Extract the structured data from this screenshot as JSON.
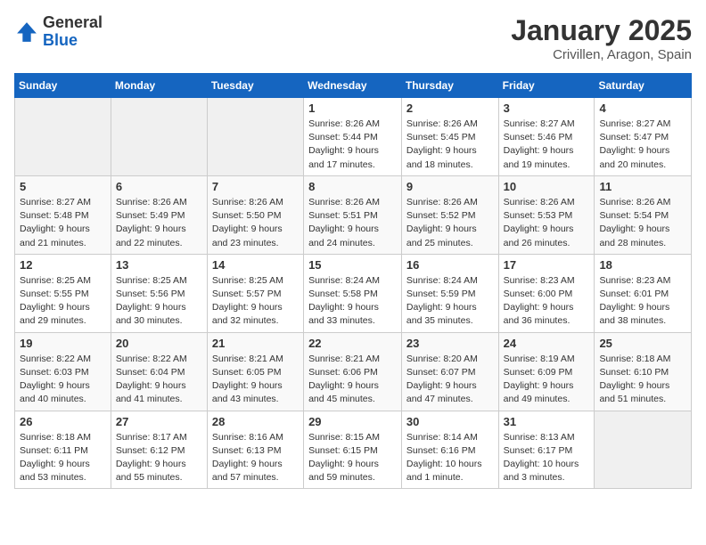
{
  "logo": {
    "general": "General",
    "blue": "Blue"
  },
  "title": "January 2025",
  "subtitle": "Crivillen, Aragon, Spain",
  "days_of_week": [
    "Sunday",
    "Monday",
    "Tuesday",
    "Wednesday",
    "Thursday",
    "Friday",
    "Saturday"
  ],
  "weeks": [
    [
      {
        "day": "",
        "info": ""
      },
      {
        "day": "",
        "info": ""
      },
      {
        "day": "",
        "info": ""
      },
      {
        "day": "1",
        "info": "Sunrise: 8:26 AM\nSunset: 5:44 PM\nDaylight: 9 hours and 17 minutes."
      },
      {
        "day": "2",
        "info": "Sunrise: 8:26 AM\nSunset: 5:45 PM\nDaylight: 9 hours and 18 minutes."
      },
      {
        "day": "3",
        "info": "Sunrise: 8:27 AM\nSunset: 5:46 PM\nDaylight: 9 hours and 19 minutes."
      },
      {
        "day": "4",
        "info": "Sunrise: 8:27 AM\nSunset: 5:47 PM\nDaylight: 9 hours and 20 minutes."
      }
    ],
    [
      {
        "day": "5",
        "info": "Sunrise: 8:27 AM\nSunset: 5:48 PM\nDaylight: 9 hours and 21 minutes."
      },
      {
        "day": "6",
        "info": "Sunrise: 8:26 AM\nSunset: 5:49 PM\nDaylight: 9 hours and 22 minutes."
      },
      {
        "day": "7",
        "info": "Sunrise: 8:26 AM\nSunset: 5:50 PM\nDaylight: 9 hours and 23 minutes."
      },
      {
        "day": "8",
        "info": "Sunrise: 8:26 AM\nSunset: 5:51 PM\nDaylight: 9 hours and 24 minutes."
      },
      {
        "day": "9",
        "info": "Sunrise: 8:26 AM\nSunset: 5:52 PM\nDaylight: 9 hours and 25 minutes."
      },
      {
        "day": "10",
        "info": "Sunrise: 8:26 AM\nSunset: 5:53 PM\nDaylight: 9 hours and 26 minutes."
      },
      {
        "day": "11",
        "info": "Sunrise: 8:26 AM\nSunset: 5:54 PM\nDaylight: 9 hours and 28 minutes."
      }
    ],
    [
      {
        "day": "12",
        "info": "Sunrise: 8:25 AM\nSunset: 5:55 PM\nDaylight: 9 hours and 29 minutes."
      },
      {
        "day": "13",
        "info": "Sunrise: 8:25 AM\nSunset: 5:56 PM\nDaylight: 9 hours and 30 minutes."
      },
      {
        "day": "14",
        "info": "Sunrise: 8:25 AM\nSunset: 5:57 PM\nDaylight: 9 hours and 32 minutes."
      },
      {
        "day": "15",
        "info": "Sunrise: 8:24 AM\nSunset: 5:58 PM\nDaylight: 9 hours and 33 minutes."
      },
      {
        "day": "16",
        "info": "Sunrise: 8:24 AM\nSunset: 5:59 PM\nDaylight: 9 hours and 35 minutes."
      },
      {
        "day": "17",
        "info": "Sunrise: 8:23 AM\nSunset: 6:00 PM\nDaylight: 9 hours and 36 minutes."
      },
      {
        "day": "18",
        "info": "Sunrise: 8:23 AM\nSunset: 6:01 PM\nDaylight: 9 hours and 38 minutes."
      }
    ],
    [
      {
        "day": "19",
        "info": "Sunrise: 8:22 AM\nSunset: 6:03 PM\nDaylight: 9 hours and 40 minutes."
      },
      {
        "day": "20",
        "info": "Sunrise: 8:22 AM\nSunset: 6:04 PM\nDaylight: 9 hours and 41 minutes."
      },
      {
        "day": "21",
        "info": "Sunrise: 8:21 AM\nSunset: 6:05 PM\nDaylight: 9 hours and 43 minutes."
      },
      {
        "day": "22",
        "info": "Sunrise: 8:21 AM\nSunset: 6:06 PM\nDaylight: 9 hours and 45 minutes."
      },
      {
        "day": "23",
        "info": "Sunrise: 8:20 AM\nSunset: 6:07 PM\nDaylight: 9 hours and 47 minutes."
      },
      {
        "day": "24",
        "info": "Sunrise: 8:19 AM\nSunset: 6:09 PM\nDaylight: 9 hours and 49 minutes."
      },
      {
        "day": "25",
        "info": "Sunrise: 8:18 AM\nSunset: 6:10 PM\nDaylight: 9 hours and 51 minutes."
      }
    ],
    [
      {
        "day": "26",
        "info": "Sunrise: 8:18 AM\nSunset: 6:11 PM\nDaylight: 9 hours and 53 minutes."
      },
      {
        "day": "27",
        "info": "Sunrise: 8:17 AM\nSunset: 6:12 PM\nDaylight: 9 hours and 55 minutes."
      },
      {
        "day": "28",
        "info": "Sunrise: 8:16 AM\nSunset: 6:13 PM\nDaylight: 9 hours and 57 minutes."
      },
      {
        "day": "29",
        "info": "Sunrise: 8:15 AM\nSunset: 6:15 PM\nDaylight: 9 hours and 59 minutes."
      },
      {
        "day": "30",
        "info": "Sunrise: 8:14 AM\nSunset: 6:16 PM\nDaylight: 10 hours and 1 minute."
      },
      {
        "day": "31",
        "info": "Sunrise: 8:13 AM\nSunset: 6:17 PM\nDaylight: 10 hours and 3 minutes."
      },
      {
        "day": "",
        "info": ""
      }
    ]
  ]
}
